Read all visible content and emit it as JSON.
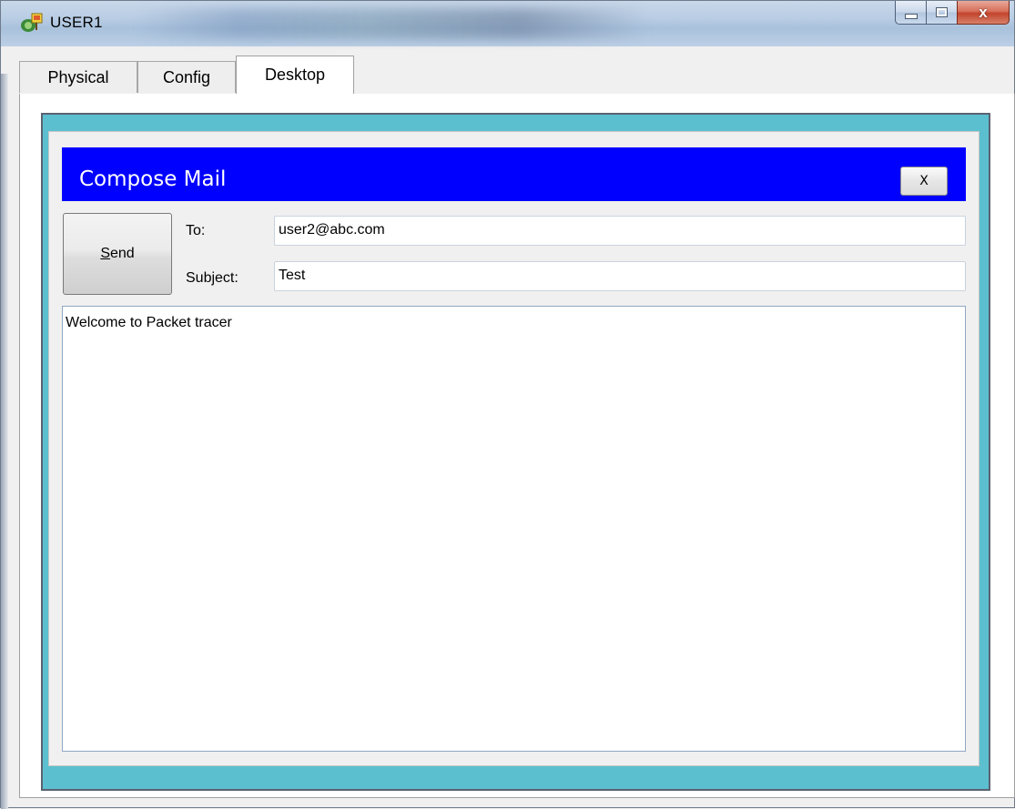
{
  "window": {
    "title": "USER1",
    "icon": "packet-tracer-pc-icon",
    "controls": {
      "minimize": "minimize-icon",
      "maximize": "maximize-icon",
      "close": "x"
    }
  },
  "tabs": [
    {
      "label": "Physical",
      "active": false
    },
    {
      "label": "Config",
      "active": false
    },
    {
      "label": "Desktop",
      "active": true
    }
  ],
  "compose": {
    "title": "Compose Mail",
    "close_label": "X",
    "send_label_first": "S",
    "send_label_rest": "end",
    "to_label": "To:",
    "to_value": "user2@abc.com",
    "subject_label": "Subject:",
    "subject_value": "Test",
    "body_text": "Welcome to Packet tracer"
  },
  "colors": {
    "header_blue": "#0000ff",
    "frame_cyan": "#5cbfcf"
  }
}
